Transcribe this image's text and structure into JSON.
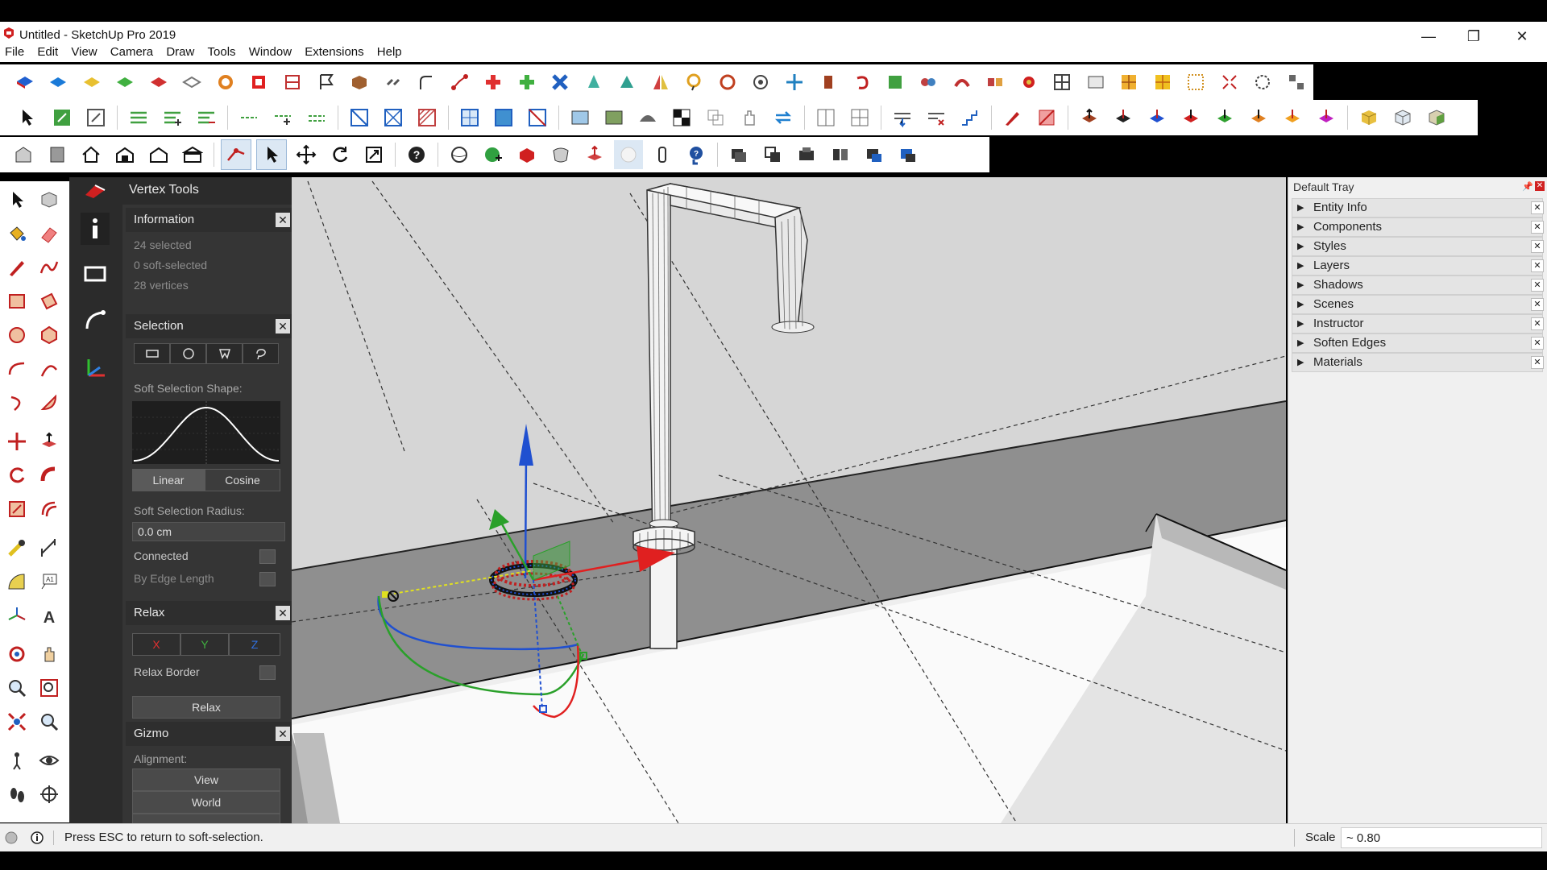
{
  "window": {
    "title": "Untitled - SketchUp Pro 2019",
    "minimize_glyph": "—",
    "restore_glyph": "❐",
    "close_glyph": "✕"
  },
  "menu": [
    "File",
    "Edit",
    "View",
    "Camera",
    "Draw",
    "Tools",
    "Window",
    "Extensions",
    "Help"
  ],
  "vertex_tools": {
    "title": "Vertex Tools",
    "information": {
      "header": "Information",
      "selected": "24 selected",
      "soft_selected": "0 soft-selected",
      "vertices": "28 vertices"
    },
    "selection": {
      "header": "Selection",
      "soft_selection_shape_label": "Soft Selection Shape:",
      "linear_label": "Linear",
      "cosine_label": "Cosine",
      "radius_label": "Soft Selection Radius:",
      "radius_value": "0.0 cm",
      "connected_label": "Connected",
      "by_edge_length_label": "By Edge Length"
    },
    "relax": {
      "header": "Relax",
      "x_label": "X",
      "y_label": "Y",
      "z_label": "Z",
      "relax_border_label": "Relax Border",
      "relax_button": "Relax"
    },
    "gizmo": {
      "header": "Gizmo",
      "alignment_label": "Alignment:",
      "view_button": "View",
      "world_button": "World"
    }
  },
  "tray": {
    "title": "Default Tray",
    "items": [
      "Entity Info",
      "Components",
      "Styles",
      "Layers",
      "Shadows",
      "Scenes",
      "Instructor",
      "Soften Edges",
      "Materials"
    ]
  },
  "status": {
    "message": "Press ESC to return to soft-selection.",
    "scale_label": "Scale",
    "scale_value": "~ 0.80"
  },
  "colors": {
    "axis_red": "#e02020",
    "axis_green": "#2aa02a",
    "axis_blue": "#2050e0",
    "panel_dark": "#353535"
  }
}
